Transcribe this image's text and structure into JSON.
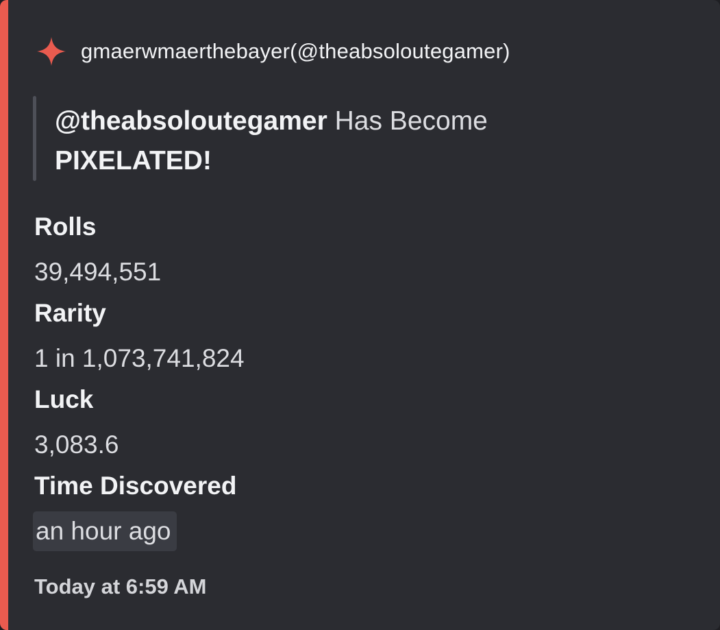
{
  "embed": {
    "accent_color": "#ea5b4f",
    "author": {
      "icon": "sparkle-icon",
      "name": "gmaerwmaerthebayer(@theabsoloutegamer)"
    },
    "quote": {
      "mention": "@theabsoloutegamer",
      "text": " Has Become",
      "emphasis": "PIXELATED!"
    },
    "fields": [
      {
        "name": "Rolls",
        "value": "39,494,551"
      },
      {
        "name": "Rarity",
        "value": "1 in 1,073,741,824"
      },
      {
        "name": "Luck",
        "value": "3,083.6"
      },
      {
        "name": "Time Discovered",
        "value": "an hour ago"
      }
    ],
    "footer": "Today at 6:59 AM"
  }
}
